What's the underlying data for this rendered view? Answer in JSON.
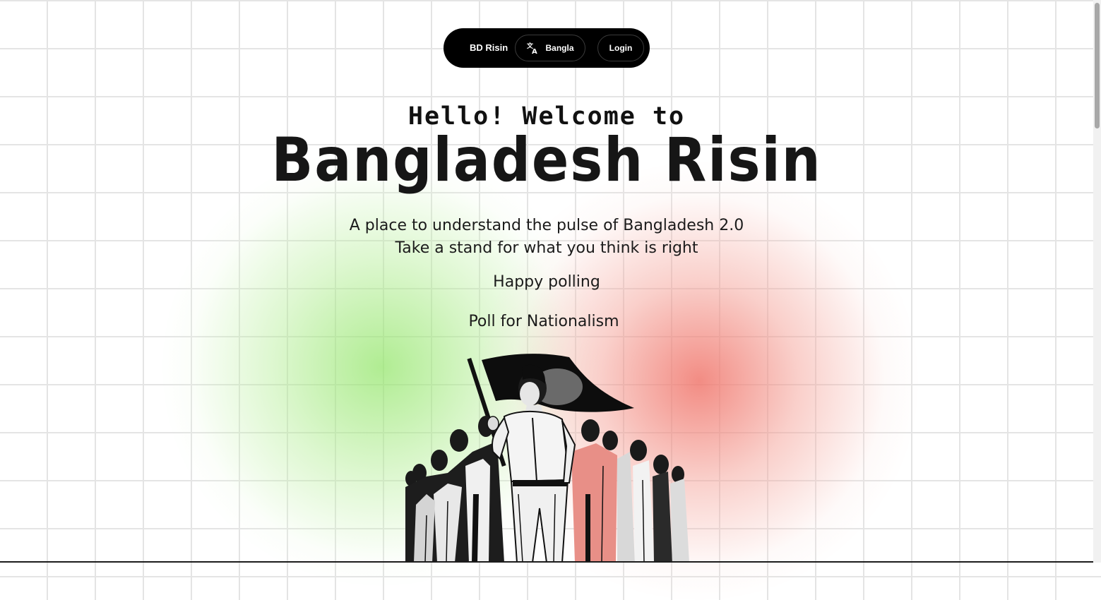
{
  "nav": {
    "brand": "BD Risin",
    "language_label": "Bangla",
    "login_label": "Login"
  },
  "hero": {
    "welcome": "Hello! Welcome to",
    "title": "Bangladesh Risin",
    "tagline_1": "A place to understand the pulse of Bangladesh 2.0",
    "tagline_2": "Take a stand for what you think is right",
    "tagline_3": "Happy polling",
    "poll_link": "Poll for Nationalism"
  },
  "icons": {
    "language": "translate-icon",
    "illustration": "protest-crowd-with-flag"
  },
  "colors": {
    "nav_bg": "#000000",
    "text": "#161616",
    "glow_green": "#96e66e",
    "glow_red": "#f0786e",
    "grid": "#e4e4e4"
  }
}
